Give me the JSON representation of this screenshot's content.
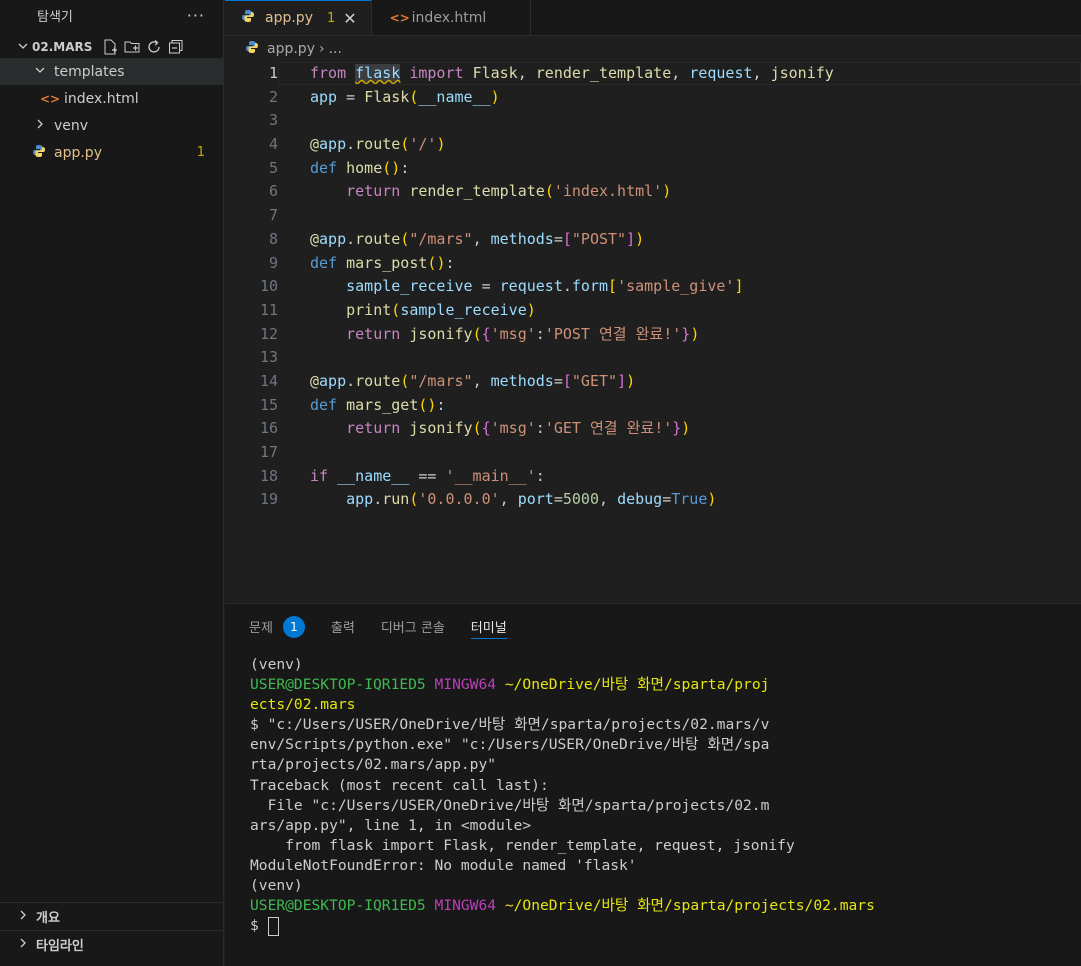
{
  "explorer": {
    "title": "탐색기",
    "more": "···",
    "folder": "02.MARS",
    "items": [
      {
        "label": "templates"
      },
      {
        "label": "index.html"
      },
      {
        "label": "venv"
      },
      {
        "label": "app.py",
        "badge": "1"
      }
    ],
    "outline": "개요",
    "timeline": "타임라인"
  },
  "tabs": [
    {
      "label": "app.py",
      "modified": "1",
      "close": "✕"
    },
    {
      "label": "index.html"
    }
  ],
  "breadcrumb": {
    "file": "app.py",
    "sep": "›",
    "rest": "..."
  },
  "editor": {
    "lines": [
      "from flask import Flask, render_template, request, jsonify",
      "app = Flask(__name__)",
      "",
      "@app.route('/')",
      "def home():",
      "    return render_template('index.html')",
      "",
      "@app.route(\"/mars\", methods=[\"POST\"])",
      "def mars_post():",
      "    sample_receive = request.form['sample_give']",
      "    print(sample_receive)",
      "    return jsonify({'msg':'POST 연결 완료!'})",
      "",
      "@app.route(\"/mars\", methods=[\"GET\"])",
      "def mars_get():",
      "    return jsonify({'msg':'GET 연결 완료!'})",
      "",
      "if __name__ == '__main__':",
      "    app.run('0.0.0.0', port=5000, debug=True)"
    ],
    "line_numbers": [
      "1",
      "2",
      "3",
      "4",
      "5",
      "6",
      "7",
      "8",
      "9",
      "10",
      "11",
      "12",
      "13",
      "14",
      "15",
      "16",
      "17",
      "18",
      "19"
    ]
  },
  "panel": {
    "tabs": [
      {
        "label": "문제",
        "count": "1"
      },
      {
        "label": "출력"
      },
      {
        "label": "디버그 콘솔"
      },
      {
        "label": "터미널"
      }
    ]
  },
  "terminal": {
    "venv": "(venv)",
    "user": "USER@DESKTOP-IQR1ED5",
    "shell": "MINGW64",
    "path1a": "~/OneDrive/바탕 화면/sparta/proj",
    "path1b": "ects/02.mars",
    "cmd1": "$ \"c:/Users/USER/OneDrive/바탕 화면/sparta/projects/02.mars/v",
    "cmd2": "env/Scripts/python.exe\" \"c:/Users/USER/OneDrive/바탕 화면/spa",
    "cmd3": "rta/projects/02.mars/app.py\"",
    "tb1": "Traceback (most recent call last):",
    "tb2": "  File \"c:/Users/USER/OneDrive/바탕 화면/sparta/projects/02.m",
    "tb3": "ars/app.py\", line 1, in <module>",
    "tb4": "    from flask import Flask, render_template, request, jsonify",
    "tb5": "ModuleNotFoundError: No module named 'flask'",
    "venv2": "(venv)",
    "path2": "~/OneDrive/바탕 화면/sparta/projects/02.mars",
    "prompt": "$ "
  },
  "colors": {
    "accent": "#0078d4",
    "warning": "#cca700",
    "html_icon": "#e37933",
    "terminal_green": "#3fb950",
    "terminal_purple": "#bc3fbc",
    "terminal_yellow": "#e5e510"
  }
}
